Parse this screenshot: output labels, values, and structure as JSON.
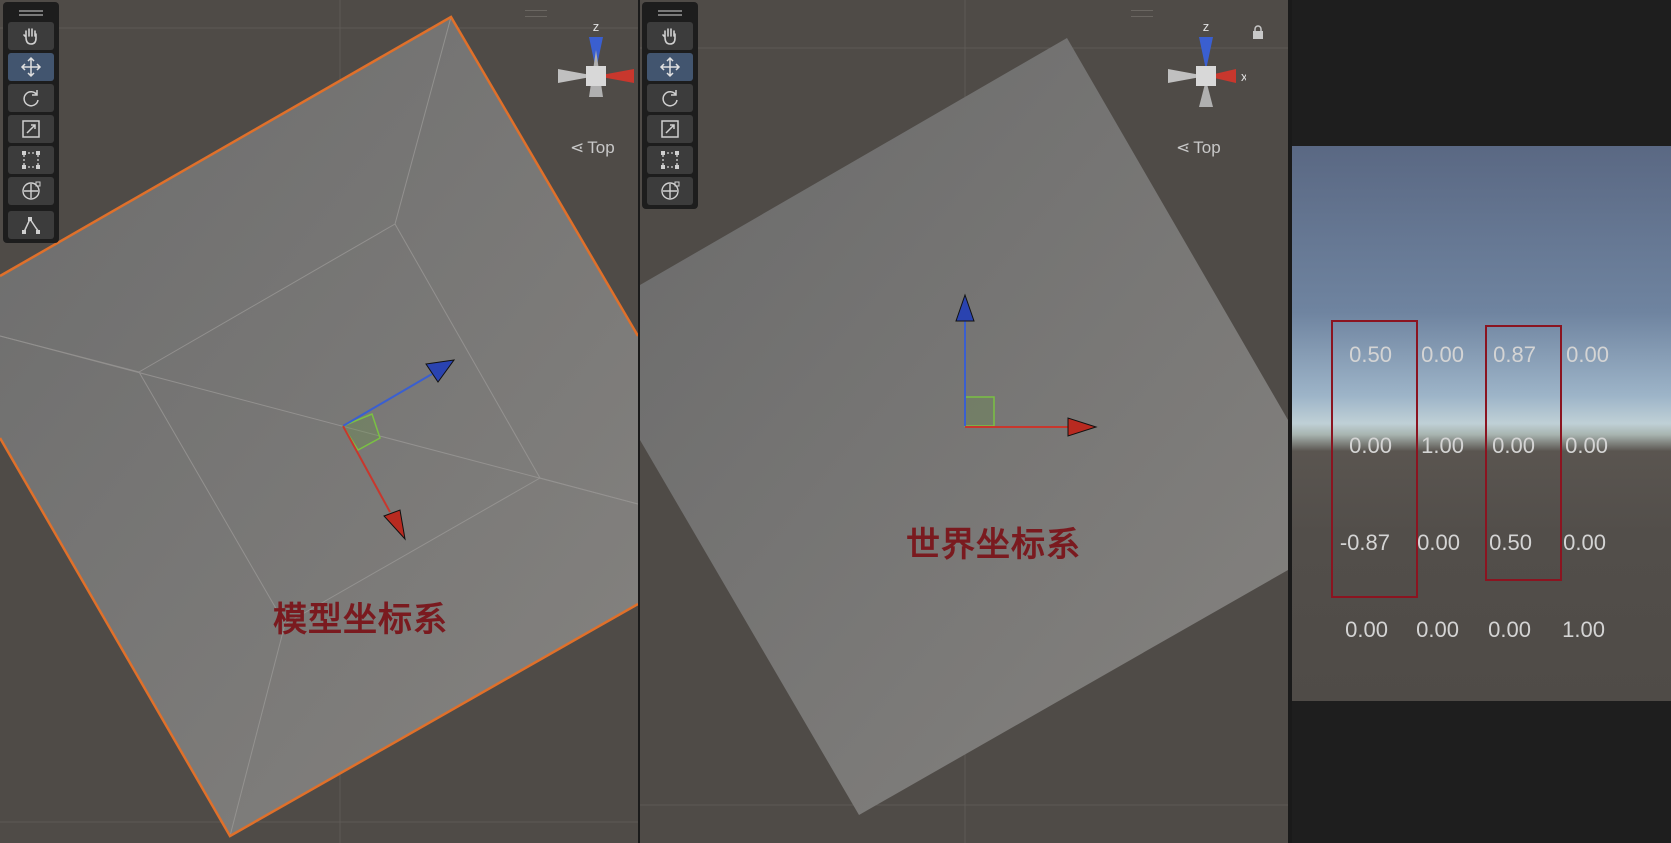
{
  "left_view": {
    "label": "模型坐标系",
    "orientation_label": "Top",
    "gizmo_axis_z": "z",
    "toolbar_tools": [
      {
        "icon": "hand-icon",
        "active": false
      },
      {
        "icon": "move-icon",
        "active": true
      },
      {
        "icon": "rotate-icon",
        "active": false
      },
      {
        "icon": "scale-icon",
        "active": false
      },
      {
        "icon": "rect-tool-icon",
        "active": false
      },
      {
        "icon": "transform-icon",
        "active": false
      },
      {
        "icon": "custom-tool-icon",
        "active": false
      }
    ]
  },
  "right_view": {
    "label": "世界坐标系",
    "orientation_label": "Top",
    "gizmo_axis_z": "z",
    "gizmo_axis_x": "x",
    "lock_icon": "lock-icon",
    "toolbar_tools": [
      {
        "icon": "hand-icon",
        "active": false
      },
      {
        "icon": "move-icon",
        "active": true
      },
      {
        "icon": "rotate-icon",
        "active": false
      },
      {
        "icon": "scale-icon",
        "active": false
      },
      {
        "icon": "rect-tool-icon",
        "active": false
      },
      {
        "icon": "transform-icon",
        "active": false
      }
    ]
  },
  "matrix": {
    "rows": [
      [
        "0.50",
        "0.00",
        "0.87",
        "0.00"
      ],
      [
        "0.00",
        "1.00",
        "0.00",
        "0.00"
      ],
      [
        "-0.87",
        "0.00",
        "0.50",
        "0.00"
      ],
      [
        "0.00",
        "0.00",
        "0.00",
        "1.00"
      ]
    ],
    "highlighted_columns": [
      0,
      2
    ],
    "highlight_color": "#8b1420"
  },
  "colors": {
    "viewport_bg": "#4f4b47",
    "selection_outline": "#e0702a",
    "axis_x": "#c8372d",
    "axis_y": "#6bbf3a",
    "axis_z": "#3a5fd0",
    "label_color": "#7a1a1f"
  }
}
